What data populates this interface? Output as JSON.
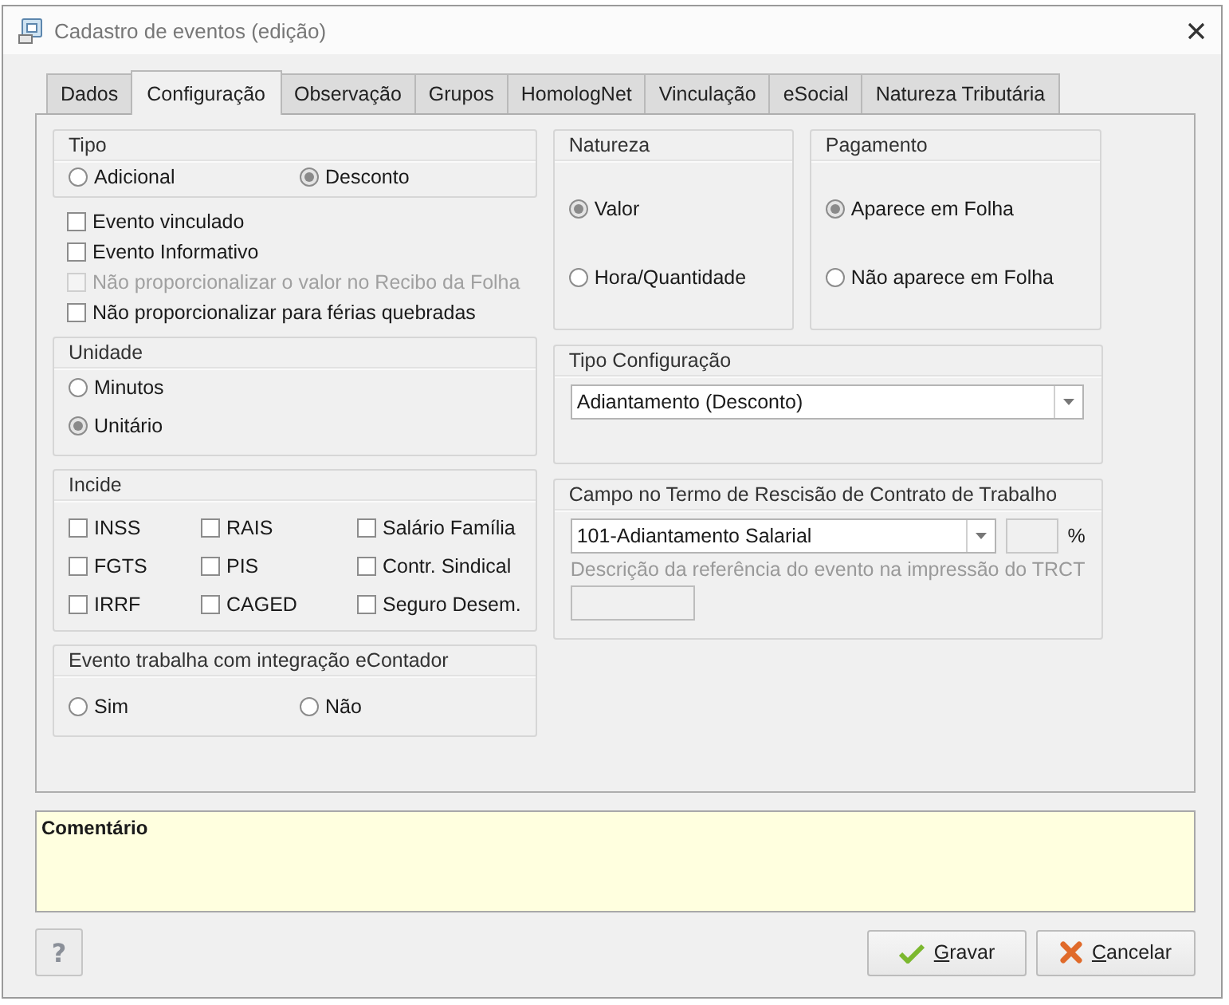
{
  "window": {
    "title": "Cadastro de eventos (edição)"
  },
  "tabs": [
    {
      "label": "Dados",
      "selected": false
    },
    {
      "label": "Configuração",
      "selected": true
    },
    {
      "label": "Observação",
      "selected": false
    },
    {
      "label": "Grupos",
      "selected": false
    },
    {
      "label": "HomologNet",
      "selected": false
    },
    {
      "label": "Vinculação",
      "selected": false
    },
    {
      "label": "eSocial",
      "selected": false
    },
    {
      "label": "Natureza Tributária",
      "selected": false
    }
  ],
  "tipo": {
    "title": "Tipo",
    "options": [
      {
        "label": "Adicional",
        "selected": false
      },
      {
        "label": "Desconto",
        "selected": true
      }
    ]
  },
  "flags": [
    {
      "label": "Evento vinculado",
      "checked": false,
      "disabled": false
    },
    {
      "label": "Evento Informativo",
      "checked": false,
      "disabled": false
    },
    {
      "label": "Não proporcionalizar o valor no Recibo da Folha",
      "checked": false,
      "disabled": true
    },
    {
      "label": "Não proporcionalizar para férias quebradas",
      "checked": false,
      "disabled": false
    }
  ],
  "unidade": {
    "title": "Unidade",
    "options": [
      {
        "label": "Minutos",
        "selected": false
      },
      {
        "label": "Unitário",
        "selected": true
      }
    ]
  },
  "incide": {
    "title": "Incide",
    "items": [
      {
        "label": "INSS",
        "checked": false
      },
      {
        "label": "RAIS",
        "checked": false
      },
      {
        "label": "Salário Família",
        "checked": false
      },
      {
        "label": "FGTS",
        "checked": false
      },
      {
        "label": "PIS",
        "checked": false
      },
      {
        "label": "Contr. Sindical",
        "checked": false
      },
      {
        "label": "IRRF",
        "checked": false
      },
      {
        "label": "CAGED",
        "checked": false
      },
      {
        "label": "Seguro Desem.",
        "checked": false
      }
    ]
  },
  "econtador": {
    "title": "Evento trabalha com integração eContador",
    "options": [
      {
        "label": "Sim",
        "selected": false
      },
      {
        "label": "Não",
        "selected": false
      }
    ]
  },
  "natureza": {
    "title": "Natureza",
    "options": [
      {
        "label": "Valor",
        "selected": true
      },
      {
        "label": "Hora/Quantidade",
        "selected": false
      }
    ]
  },
  "pagamento": {
    "title": "Pagamento",
    "options": [
      {
        "label": "Aparece em Folha",
        "selected": true
      },
      {
        "label": "Não aparece em Folha",
        "selected": false
      }
    ]
  },
  "tipo_configuracao": {
    "title": "Tipo Configuração",
    "value": "Adiantamento (Desconto)"
  },
  "campo_trct": {
    "title": "Campo no Termo de Rescisão de Contrato de Trabalho",
    "value": "101-Adiantamento Salarial",
    "percent_symbol": "%",
    "description_label": "Descrição da referência do evento na impressão do TRCT"
  },
  "comment": {
    "label": "Comentário"
  },
  "buttons": {
    "help": "?",
    "save": "Gravar",
    "cancel": "Cancelar"
  }
}
